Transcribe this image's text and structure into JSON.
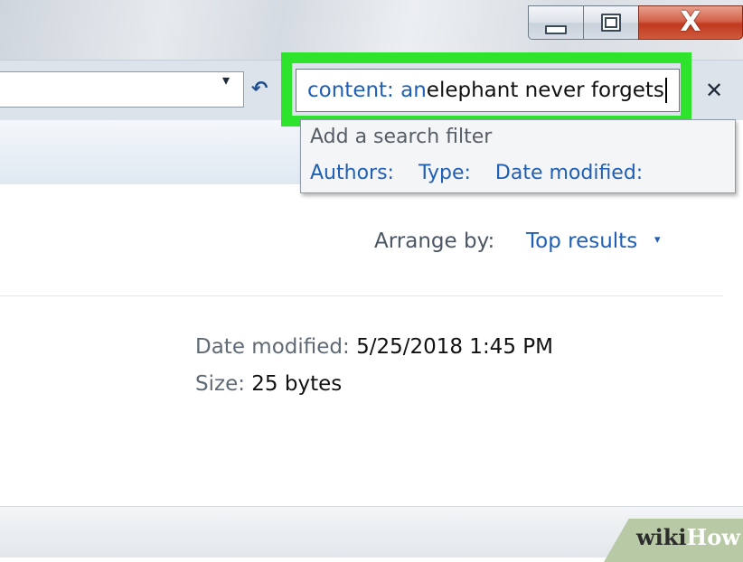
{
  "window": {
    "buttons": {
      "minimize_icon": "minimize-icon",
      "maximize_icon": "maximize-icon",
      "close_icon": "close-icon",
      "close_glyph": "X"
    }
  },
  "addressbar": {
    "dropdown_glyph": "▾",
    "refresh_glyph": "↶"
  },
  "search": {
    "query_keyword": "content: an",
    "query_value": " elephant never forgets",
    "clear_glyph": "✕",
    "highlight_color": "#2ee32b"
  },
  "search_dropdown": {
    "title": "Add a search filter",
    "filters": [
      "Authors:",
      "Type:",
      "Date modified:"
    ]
  },
  "results": {
    "arrange_label": "Arrange by:",
    "arrange_value": "Top results",
    "arrange_caret": "▾",
    "item": {
      "date_label": "Date modified:",
      "date_value": "5/25/2018 1:45 PM",
      "size_label": "Size:",
      "size_value": "25 bytes"
    }
  },
  "watermark": {
    "part1": "wiki",
    "part2": "How"
  },
  "colors": {
    "link_blue": "#1f5fb6",
    "close_red": "#c1391f"
  }
}
